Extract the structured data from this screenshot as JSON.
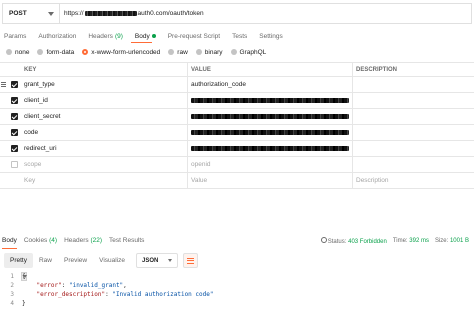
{
  "request": {
    "method": "POST",
    "url_prefix": "https://",
    "url_suffix": "auth0.com/oauth/token"
  },
  "request_tabs": [
    {
      "label": "Params",
      "count": "",
      "active": false
    },
    {
      "label": "Authorization",
      "count": "",
      "active": false
    },
    {
      "label": "Headers",
      "count": "(9)",
      "active": false
    },
    {
      "label": "Body",
      "count": "",
      "active": true
    },
    {
      "label": "Pre-request Script",
      "count": "",
      "active": false
    },
    {
      "label": "Tests",
      "count": "",
      "active": false
    },
    {
      "label": "Settings",
      "count": "",
      "active": false
    }
  ],
  "body_types": [
    {
      "label": "none",
      "selected": false
    },
    {
      "label": "form-data",
      "selected": false
    },
    {
      "label": "x-www-form-urlencoded",
      "selected": true
    },
    {
      "label": "raw",
      "selected": false
    },
    {
      "label": "binary",
      "selected": false
    },
    {
      "label": "GraphQL",
      "selected": false
    }
  ],
  "table": {
    "headers": {
      "key": "KEY",
      "value": "VALUE",
      "description": "DESCRIPTION"
    },
    "rows": [
      {
        "key": "grant_type",
        "value": "authorization_code",
        "checked": true,
        "redacted": false
      },
      {
        "key": "client_id",
        "value": "",
        "checked": true,
        "redacted": true
      },
      {
        "key": "client_secret",
        "value": "",
        "checked": true,
        "redacted": true
      },
      {
        "key": "code",
        "value": "",
        "checked": true,
        "redacted": true
      },
      {
        "key": "redirect_uri",
        "value": "",
        "checked": true,
        "redacted": true
      },
      {
        "key": "scope",
        "value": "openid",
        "checked": false,
        "redacted": false
      }
    ],
    "placeholder": {
      "key": "Key",
      "value": "Value",
      "description": "Description"
    }
  },
  "response_tabs": [
    {
      "label": "Body",
      "count": "",
      "active": true
    },
    {
      "label": "Cookies",
      "count": "(4)",
      "active": false
    },
    {
      "label": "Headers",
      "count": "(22)",
      "active": false
    },
    {
      "label": "Test Results",
      "count": "",
      "active": false
    }
  ],
  "response_status": {
    "status_label": "Status:",
    "status_value": "403 Forbidden",
    "time_label": "Time:",
    "time_value": "392 ms",
    "size_label": "Size:",
    "size_value": "1001 B"
  },
  "view_modes": [
    {
      "label": "Pretty",
      "active": true
    },
    {
      "label": "Raw",
      "active": false
    },
    {
      "label": "Preview",
      "active": false
    },
    {
      "label": "Visualize",
      "active": false
    }
  ],
  "format": "JSON",
  "code_lines": [
    {
      "n": "1",
      "text": "{"
    },
    {
      "n": "2",
      "key": "\"error\"",
      "value": "\"invalid_grant\"",
      "trail": ","
    },
    {
      "n": "3",
      "key": "\"error_description\"",
      "value": "\"Invalid authorization code\"",
      "trail": ""
    },
    {
      "n": "4",
      "text": "}"
    }
  ],
  "colors": {
    "accent": "#ff6c37",
    "success": "#0aa14b"
  }
}
